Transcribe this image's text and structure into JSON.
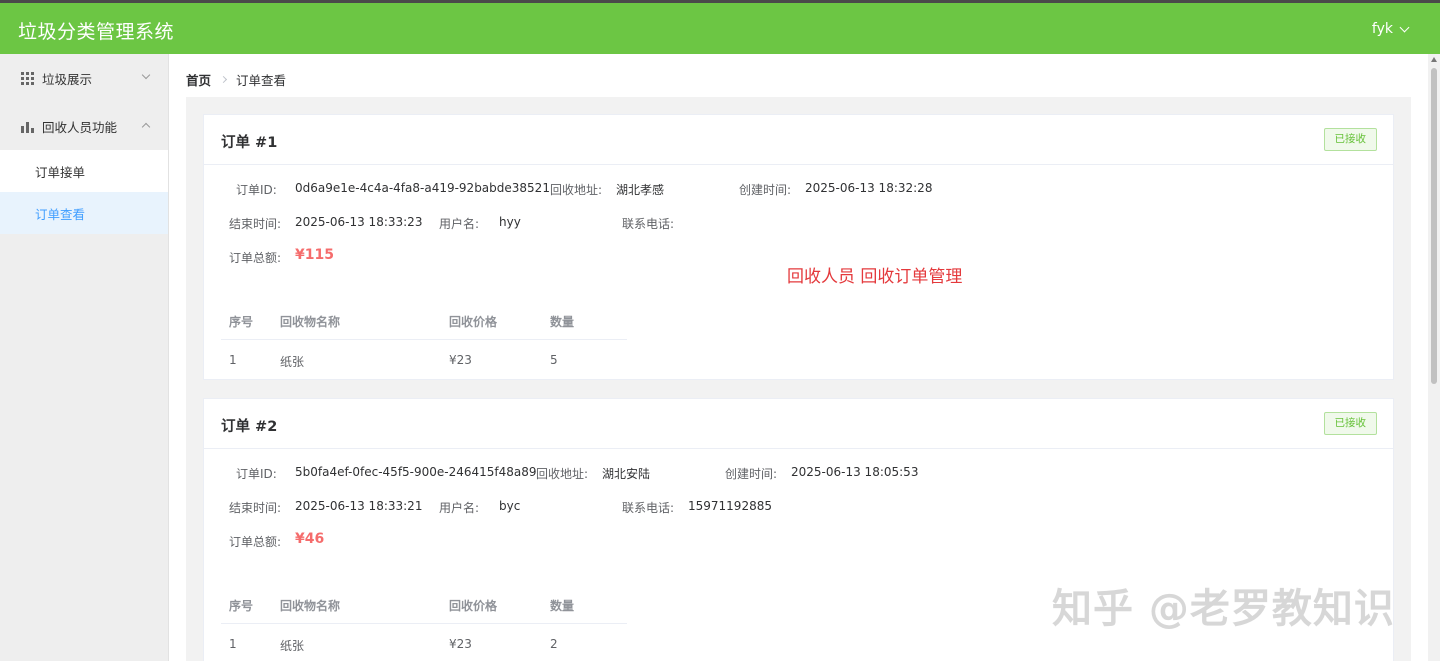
{
  "app": {
    "title": "垃圾分类管理系统",
    "user": "fyk"
  },
  "sidebar": {
    "groups": [
      {
        "label": "垃圾展示",
        "icon": "grid-icon",
        "expanded": false
      },
      {
        "label": "回收人员功能",
        "icon": "bar-chart-icon",
        "expanded": true,
        "items": [
          {
            "label": "订单接单",
            "active": false
          },
          {
            "label": "订单查看",
            "active": true
          }
        ]
      }
    ]
  },
  "breadcrumb": {
    "home": "首页",
    "current": "订单查看"
  },
  "labels": {
    "order_id": "订单ID:",
    "address": "回收地址:",
    "created": "创建时间:",
    "ended": "结束时间:",
    "username": "用户名:",
    "phone": "联系电话:",
    "total": "订单总额:"
  },
  "table_headers": [
    "序号",
    "回收物名称",
    "回收价格",
    "数量"
  ],
  "orders": [
    {
      "title": "订单 #1",
      "status": "已接收",
      "id": "0d6a9e1e-4c4a-4fa8-a419-92babde38521",
      "address": "湖北孝感",
      "created": "2025-06-13 18:32:28",
      "ended": "2025-06-13 18:33:23",
      "username": "hyy",
      "phone": "",
      "total": "¥115",
      "items": [
        {
          "no": "1",
          "name": "纸张",
          "price": "¥23",
          "qty": "5"
        }
      ]
    },
    {
      "title": "订单 #2",
      "status": "已接收",
      "id": "5b0fa4ef-0fec-45f5-900e-246415f48a89",
      "address": "湖北安陆",
      "created": "2025-06-13 18:05:53",
      "ended": "2025-06-13 18:33:21",
      "username": "byc",
      "phone": "15971192885",
      "total": "¥46",
      "items": [
        {
          "no": "1",
          "name": "纸张",
          "price": "¥23",
          "qty": "2"
        }
      ]
    }
  ],
  "overlay_text": "回收人员 回收订单管理",
  "watermark": "知乎 @老罗教知识",
  "colors": {
    "header": "#6cc644",
    "accent": "#409eff",
    "total": "#f56c6c",
    "tag": "#67c23a"
  }
}
